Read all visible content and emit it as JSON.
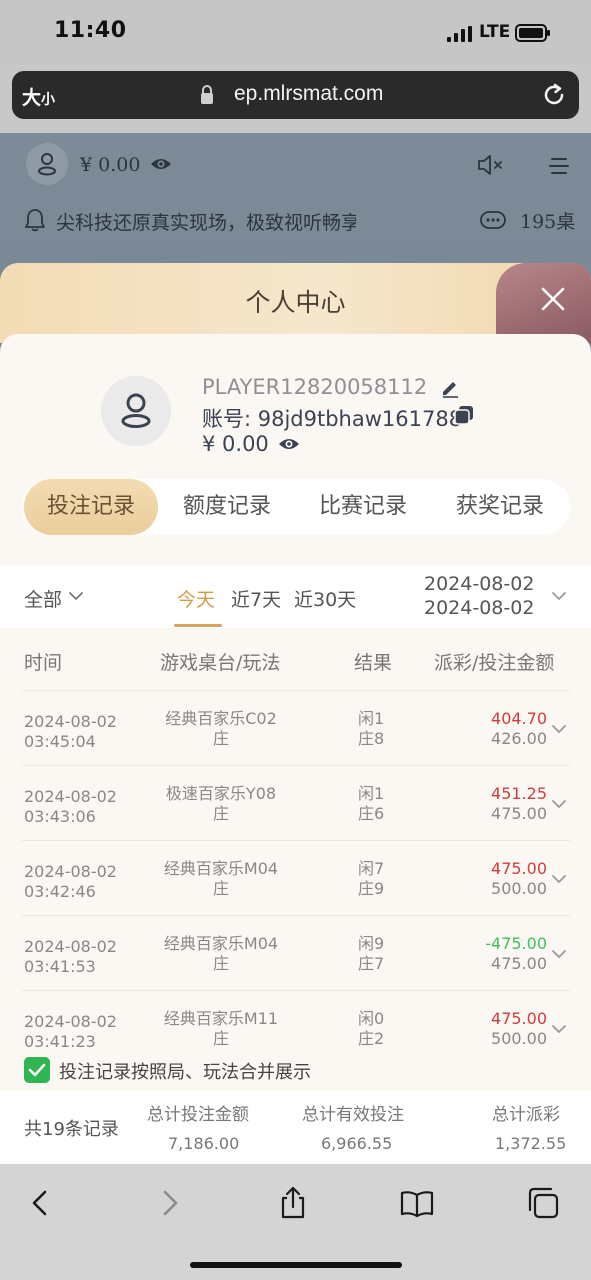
{
  "status_bar": {
    "time": "11:40",
    "network": "LTE"
  },
  "browser": {
    "text_size": "大",
    "text_size_small": "小",
    "url": "ep.mlrsmat.com"
  },
  "site_header": {
    "balance": "¥ 0.00",
    "notice": "尖科技还原真实现场，极致视听畅享",
    "tables": "195桌"
  },
  "modal": {
    "title": "个人中心",
    "player_name": "PLAYER12820058112",
    "account": "账号: 98jd9tbhaw161788",
    "balance": "¥ 0.00",
    "tabs": [
      {
        "label": "投注记录",
        "active": true
      },
      {
        "label": "额度记录",
        "active": false
      },
      {
        "label": "比赛记录",
        "active": false
      },
      {
        "label": "获奖记录",
        "active": false
      }
    ]
  },
  "filters": {
    "category": "全部",
    "periods": [
      {
        "label": "今天",
        "active": true
      },
      {
        "label": "近7天",
        "active": false
      },
      {
        "label": "近30天",
        "active": false
      }
    ],
    "date_from": "2024-08-02",
    "date_to": "2024-08-02"
  },
  "table": {
    "columns": [
      "时间",
      "游戏桌台/玩法",
      "结果",
      "派彩/投注金额"
    ],
    "rows": [
      {
        "date": "2024-08-02",
        "time": "03:45:04",
        "game": "经典百家乐C02",
        "bet": "庄",
        "result1": "闲1",
        "result2": "庄8",
        "payout": "404.70",
        "payout_positive": true,
        "stake": "426.00"
      },
      {
        "date": "2024-08-02",
        "time": "03:43:06",
        "game": "极速百家乐Y08",
        "bet": "庄",
        "result1": "闲1",
        "result2": "庄6",
        "payout": "451.25",
        "payout_positive": true,
        "stake": "475.00"
      },
      {
        "date": "2024-08-02",
        "time": "03:42:46",
        "game": "经典百家乐M04",
        "bet": "庄",
        "result1": "闲7",
        "result2": "庄9",
        "payout": "475.00",
        "payout_positive": true,
        "stake": "500.00"
      },
      {
        "date": "2024-08-02",
        "time": "03:41:53",
        "game": "经典百家乐M04",
        "bet": "庄",
        "result1": "闲9",
        "result2": "庄7",
        "payout": "-475.00",
        "payout_positive": false,
        "stake": "475.00"
      },
      {
        "date": "2024-08-02",
        "time": "03:41:23",
        "game": "经典百家乐M11",
        "bet": "庄",
        "result1": "闲0",
        "result2": "庄2",
        "payout": "475.00",
        "payout_positive": true,
        "stake": "500.00"
      }
    ]
  },
  "merge_option": {
    "label": "投注记录按照局、玩法合并展示",
    "checked": true
  },
  "summary": {
    "count": "共19条记录",
    "total_bet_label": "总计投注金额",
    "total_bet": "7,186.00",
    "total_valid_label": "总计有效投注",
    "total_valid": "6,966.55",
    "total_payout_label": "总计派彩",
    "total_payout": "1,372.55"
  },
  "colors": {
    "accent": "#d29b45",
    "positive": "#d33c3c",
    "negative": "#3ec25a",
    "check": "#2fb551"
  }
}
